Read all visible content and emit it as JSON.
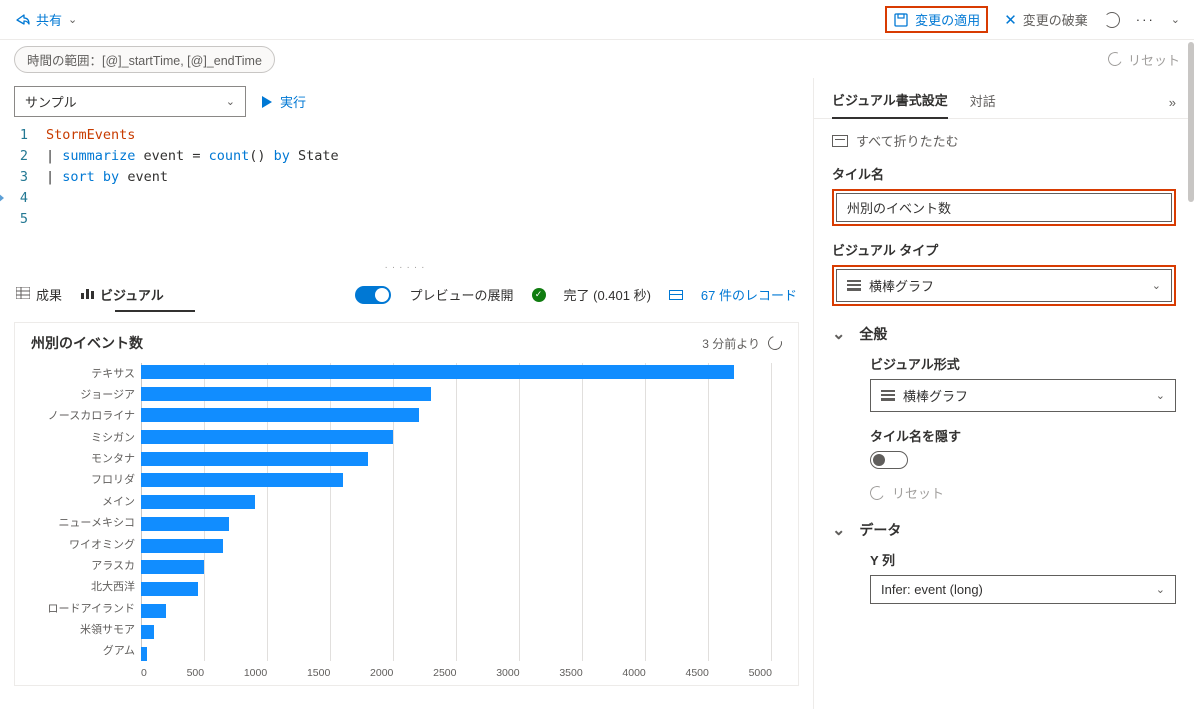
{
  "toolbar": {
    "share_label": "共有",
    "apply_changes_label": "変更の適用",
    "discard_changes_label": "変更の破棄"
  },
  "pill_row": {
    "time_range_label": "時間の範囲：[@]_startTime, [@]_endTime",
    "reset_label": "リセット"
  },
  "query_row": {
    "sample_label": "サンプル",
    "run_label": "実行"
  },
  "editor": {
    "lines": [
      {
        "n": "1",
        "html": "StormEvents",
        "classes": [
          "kw-red"
        ]
      },
      {
        "n": "2"
      },
      {
        "n": "3"
      },
      {
        "n": "4"
      },
      {
        "n": "5"
      }
    ],
    "l1_token": "StormEvents",
    "l2_a": "| ",
    "l2_b": "summarize",
    "l2_c": " event = ",
    "l2_d": "count",
    "l2_e": "() ",
    "l2_f": "by",
    "l2_g": " State",
    "l3_a": "| ",
    "l3_b": "sort",
    "l3_c": " ",
    "l3_d": "by",
    "l3_e": " event"
  },
  "result_tabs": {
    "results_label": "成果",
    "visual_label": "ビジュアル",
    "preview_label": "プレビューの展開",
    "status_label": "完了 (0.401 秒)",
    "records_label": "67 件のレコード"
  },
  "tile": {
    "title": "州別のイベント数",
    "updated": "3 分前より"
  },
  "chart_data": {
    "type": "bar",
    "orientation": "horizontal",
    "title": "州別のイベント数",
    "categories": [
      "テキサス",
      "ジョージア",
      "ノースカロライナ",
      "ミシガン",
      "モンタナ",
      "フロリダ",
      "メイン",
      "ニューメキシコ",
      "ワイオミング",
      "アラスカ",
      "北大西洋",
      "ロードアイランド",
      "米領サモア",
      "グアム"
    ],
    "values": [
      4700,
      2300,
      2200,
      2000,
      1800,
      1600,
      900,
      700,
      650,
      500,
      450,
      200,
      100,
      50
    ],
    "xlim": [
      0,
      5000
    ],
    "xticks": [
      0,
      500,
      1000,
      1500,
      2000,
      2500,
      3000,
      3500,
      4000,
      4500,
      5000
    ],
    "ylabel": "",
    "xlabel": ""
  },
  "right_panel": {
    "tab_visual": "ビジュアル書式設定",
    "tab_chat": "対話",
    "collapse_all": "すべて折りたたむ",
    "tile_name_label": "タイル名",
    "tile_name_value": "州別のイベント数",
    "visual_type_label": "ビジュアル タイプ",
    "visual_type_value": "横棒グラフ",
    "section_general": "全般",
    "visual_format_label": "ビジュアル形式",
    "visual_format_value": "横棒グラフ",
    "hide_tile_name_label": "タイル名を隠す",
    "reset_label": "リセット",
    "section_data": "データ",
    "y_col_label": "Y 列",
    "y_col_value": "Infer: event (long)"
  }
}
